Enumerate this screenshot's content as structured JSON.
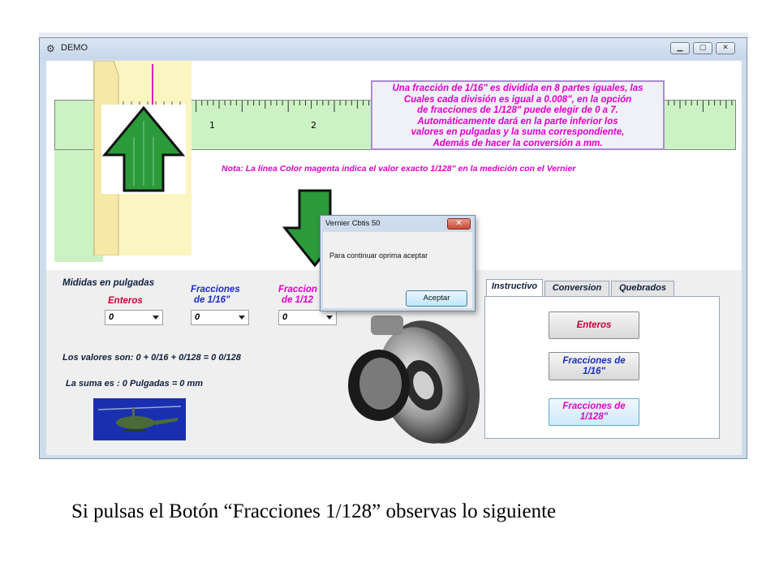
{
  "window": {
    "title": "DEMO",
    "app_icon": "gear-icon",
    "controls": {
      "minimize": "▁",
      "maximize": "▢",
      "close": "✕"
    }
  },
  "ruler": {
    "tick_labels": [
      "1",
      "2"
    ],
    "colors": {
      "ruler": "#ccf2c4",
      "slider": "#fbf5c2",
      "magenta_line": "#e020c0",
      "arrow": "#2a9a3a"
    }
  },
  "info_box": {
    "lines": [
      "Una fracción de 1/16\" es dividida en 8 partes iguales, las",
      "Cuales cada división es igual a 0.008\", en la opción",
      "de fracciones de 1/128\" puede elegir de 0 a 7.",
      "Automáticamente dará en la parte inferior los",
      "valores en pulgadas y la  suma correspondiente,",
      "Además de hacer la  conversión a mm."
    ]
  },
  "nota": "Nota: La línea Color magenta indica el valor exacto 1/128\" en la medición con el Vernier",
  "measurements": {
    "heading": "Mididas en pulgadas",
    "enteros": {
      "label": "Enteros",
      "value": "0"
    },
    "fracciones16": {
      "label_line1": "Fracciones",
      "label_line2": "de 1/16\"",
      "value": "0"
    },
    "fracciones128": {
      "label_line1": "Fraccion",
      "label_line2": "de 1/12",
      "value": "0"
    },
    "valores_text": "Los valores son: 0 + 0/16 + 0/128 = 0   0/128",
    "suma_text": "La suma es : 0 Pulgadas = 0 mm"
  },
  "tabs": [
    {
      "label": "Instructivo",
      "active": true
    },
    {
      "label": "Conversion",
      "active": false
    },
    {
      "label": "Quebrados",
      "active": false
    }
  ],
  "tab_buttons": {
    "enteros": "Enteros",
    "fracciones16_line1": "Fracciones de",
    "fracciones16_line2": "1/16\"",
    "fracciones128_line1": "Fracciones de",
    "fracciones128_line2": "1/128\""
  },
  "dialog": {
    "title": "Vernier Cbtis 50",
    "close": "✕",
    "message": "Para continuar oprima aceptar",
    "ok_label": "Aceptar"
  },
  "caption": "Si pulsas el Botón “Fracciones 1/128” observas lo siguiente"
}
